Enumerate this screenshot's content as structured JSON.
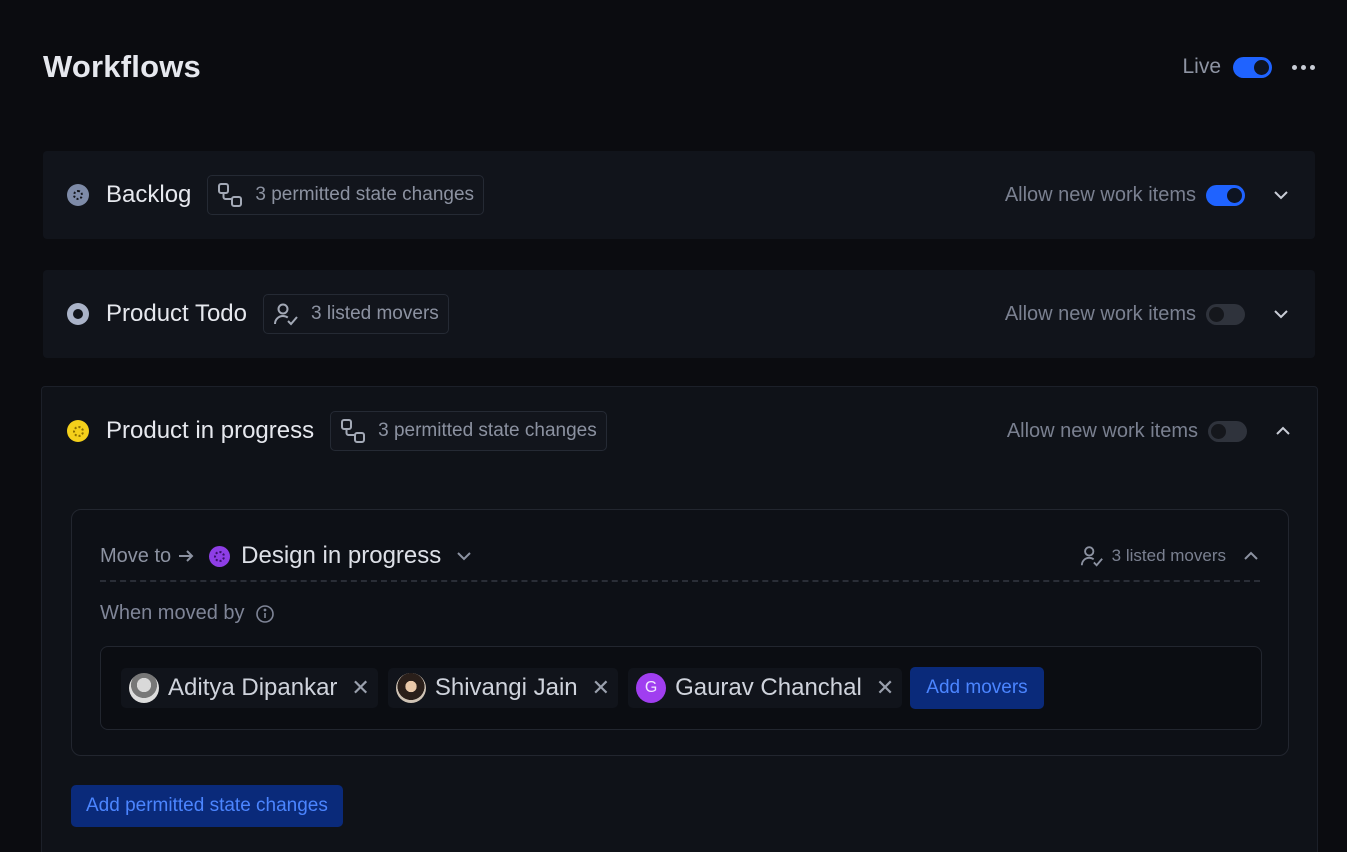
{
  "header": {
    "title": "Workflows",
    "live_label": "Live",
    "live_enabled": true,
    "more_icon": "ellipsis-icon"
  },
  "colors": {
    "accent": "#1f63ff",
    "backlog": "#7e8ba8",
    "todo": "#aab3c8",
    "in_progress": "#f4d01b",
    "design": "#8e3ee6"
  },
  "states": [
    {
      "name": "Backlog",
      "pill_icon": "state-changes-icon",
      "pill_text": "3 permitted state changes",
      "allow_label": "Allow new work items",
      "allow_enabled": true,
      "expanded": false
    },
    {
      "name": "Product Todo",
      "pill_icon": "user-check-icon",
      "pill_text": "3 listed movers",
      "allow_label": "Allow new work items",
      "allow_enabled": false,
      "expanded": false
    },
    {
      "name": "Product in progress",
      "pill_icon": "state-changes-icon",
      "pill_text": "3 permitted state changes",
      "allow_label": "Allow new work items",
      "allow_enabled": false,
      "expanded": true,
      "transition": {
        "move_to_label": "Move to",
        "target_state": "Design in progress",
        "movers_summary": "3 listed movers",
        "when_label": "When moved by",
        "movers": [
          {
            "name": "Aditya Dipankar",
            "avatar": "photo"
          },
          {
            "name": "Shivangi Jain",
            "avatar": "photo"
          },
          {
            "name": "Gaurav Chanchal",
            "avatar": "G"
          }
        ],
        "add_movers_label": "Add movers"
      },
      "add_changes_label": "Add permitted state changes"
    }
  ]
}
